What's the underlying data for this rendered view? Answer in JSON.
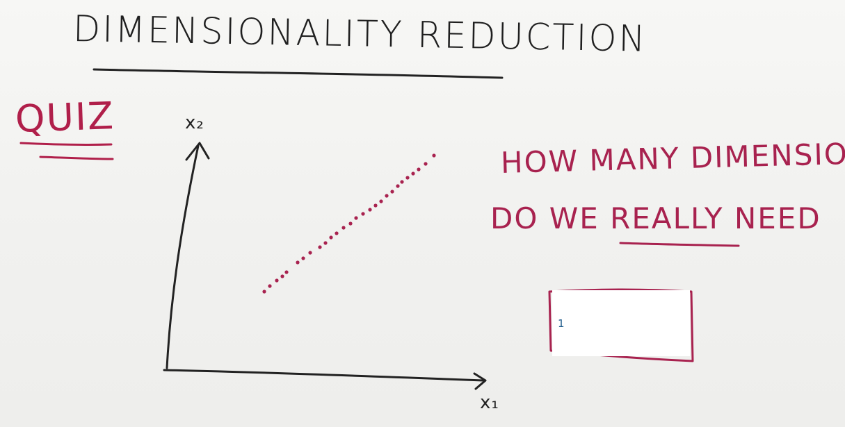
{
  "whiteboard": {
    "title": "DIMENSIONALITY REDUCTION",
    "quiz_label": "QUIZ",
    "question_line1": "HOW MANY DIMENSIONS",
    "question_line2_before": "DO WE ",
    "question_line2_emph": "REALLY",
    "question_line2_after": " NEED",
    "axis_y_label": "x₂",
    "axis_x_label": "x₁"
  },
  "answer": {
    "value": "1"
  },
  "colors": {
    "ink_black": "#1f1f1f",
    "ink_red": "#a8224f"
  }
}
